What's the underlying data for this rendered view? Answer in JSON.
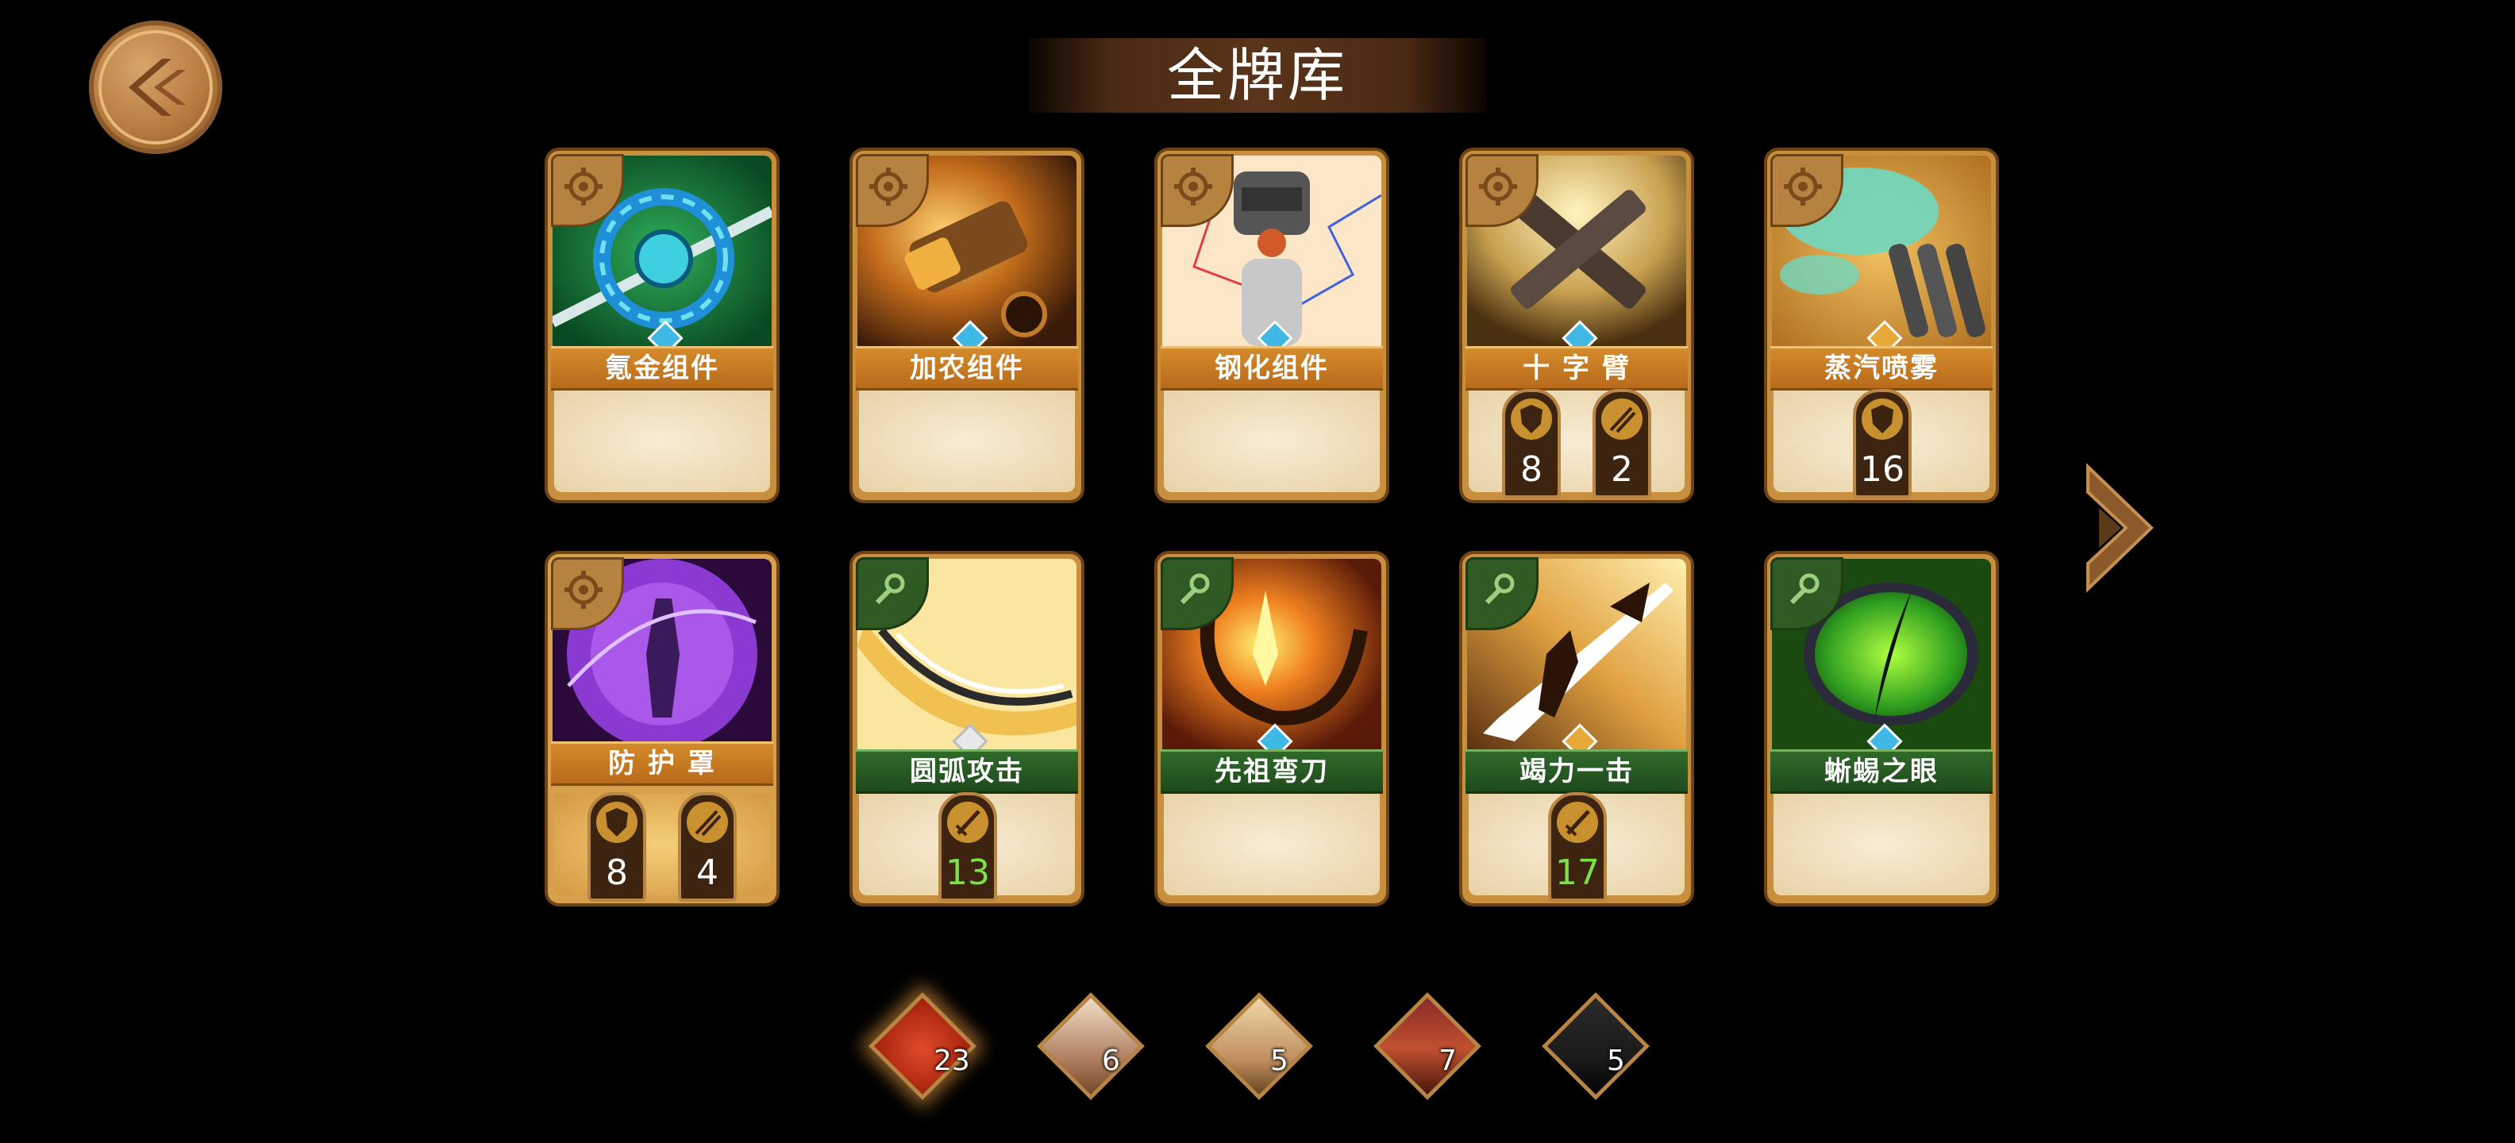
{
  "title": "全牌库",
  "cards": [
    {
      "name": "氪金组件",
      "badge": "gear",
      "gem": "blue",
      "stats": []
    },
    {
      "name": "加农组件",
      "badge": "gear",
      "gem": "blue",
      "stats": []
    },
    {
      "name": "钢化组件",
      "badge": "gear",
      "gem": "blue",
      "stats": []
    },
    {
      "name": "十 字 臂",
      "badge": "gear",
      "gem": "blue",
      "stats": [
        {
          "icon": "shield-icon",
          "value": "8"
        },
        {
          "icon": "arrows-icon",
          "value": "2"
        }
      ]
    },
    {
      "name": "蒸汽喷雾",
      "badge": "gear",
      "gem": "gold",
      "stats": [
        {
          "icon": "shield-icon",
          "value": "16"
        }
      ]
    },
    {
      "name": "防 护 罩",
      "badge": "gear",
      "gem": "none",
      "stats": [
        {
          "icon": "shield-icon",
          "value": "8"
        },
        {
          "icon": "arrows-icon",
          "value": "4"
        }
      ]
    },
    {
      "name": "圆弧攻击",
      "badge": "wrench",
      "gem": "white",
      "stats": [
        {
          "icon": "sword-icon",
          "value": "13",
          "color": "green"
        }
      ]
    },
    {
      "name": "先祖弯刀",
      "badge": "wrench",
      "gem": "blue",
      "stats": []
    },
    {
      "name": "竭力一击",
      "badge": "wrench",
      "gem": "gold",
      "stats": [
        {
          "icon": "sword-icon",
          "value": "17",
          "color": "green"
        }
      ]
    },
    {
      "name": "蜥蜴之眼",
      "badge": "wrench",
      "gem": "blue",
      "stats": []
    }
  ],
  "heroes": [
    {
      "count": "23",
      "selected": true
    },
    {
      "count": "6",
      "selected": false
    },
    {
      "count": "5",
      "selected": false
    },
    {
      "count": "7",
      "selected": false
    },
    {
      "count": "5",
      "selected": false
    }
  ],
  "colors": {
    "background": "#000000",
    "card_frame": "#c88f3e",
    "gem_blue": "#3fb8e6",
    "gem_gold": "#e6a93a",
    "value_green": "#7be04a"
  }
}
